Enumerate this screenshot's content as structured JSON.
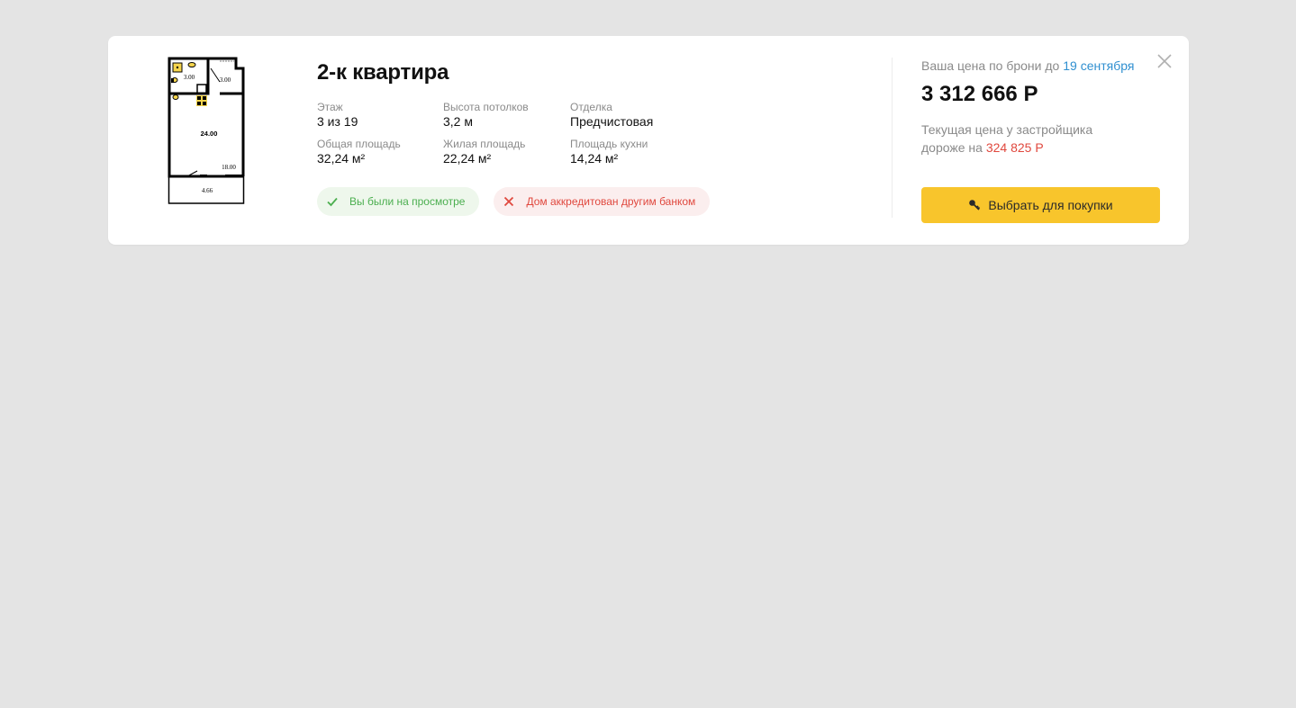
{
  "apartment": {
    "title": "2-к квартира",
    "plan": {
      "labels": [
        "3.00",
        "3.00",
        "24.00",
        "18.00",
        "4.66"
      ]
    },
    "specs": [
      {
        "label": "Этаж",
        "value": "3 из 19"
      },
      {
        "label": "Высота потолков",
        "value": "3,2 м"
      },
      {
        "label": "Отделка",
        "value": "Предчистовая"
      },
      {
        "label": "Общая площадь",
        "value": "32,24 м²"
      },
      {
        "label": "Жилая площадь",
        "value": "22,24 м²"
      },
      {
        "label": "Площадь кухни",
        "value": "14,24 м²"
      }
    ],
    "badges": {
      "viewed": {
        "label": "Вы были на просмотре",
        "icon": "check-icon",
        "color": "#4caf50"
      },
      "bank": {
        "label": "Дом аккредитован другим банком",
        "icon": "cross-icon",
        "color": "#e0483e"
      }
    }
  },
  "pricing": {
    "booking_prefix": "Ваша цена по брони до ",
    "booking_date": "19 сентября",
    "price": "3 312 666 Р",
    "current_line1": "Текущая цена у застройщика",
    "current_prefix": "дороже на ",
    "current_diff": "324 825 Р",
    "buy_button": "Выбрать для покупки",
    "buy_icon": "key-icon"
  },
  "colors": {
    "accent": "#f8c52c",
    "link": "#2f8fd0",
    "danger": "#e0483e",
    "success": "#4caf50"
  }
}
